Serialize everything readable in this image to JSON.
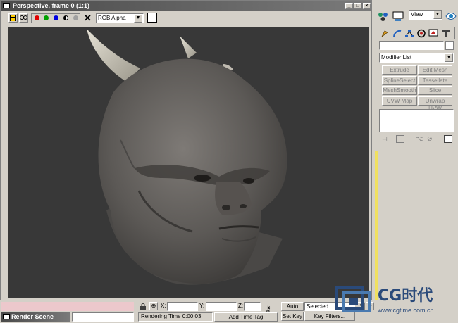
{
  "window": {
    "title": "Perspective, frame 0 (1:1)",
    "controls": [
      "_",
      "□",
      "×"
    ]
  },
  "toolbar": {
    "channel": "RGB Alpha"
  },
  "command_panel": {
    "view_dropdown": "View",
    "modifier_list": "Modifier List",
    "buttons": [
      "Extrude",
      "Edit Mesh",
      "SplineSelect",
      "Tessellate",
      "MeshSmooth",
      "Slice",
      "UVW Map",
      "Unwrap UVW"
    ]
  },
  "bottom_bar": {
    "x_label": "X:",
    "y_label": "Y:",
    "z_label": "Z:",
    "auto_key": "Auto Key",
    "selected": "Selected",
    "set_key": "Set Key",
    "key_filters": "Key Filters...",
    "rendering_time": "Rendering Time  0:00:03",
    "add_time_tag": "Add Time Tag",
    "render_scene": "Render Scene"
  },
  "watermark": {
    "brand": "CG时代",
    "url": "www.cgtime.com.cn"
  },
  "colors": {
    "viewport_bg": "#383838",
    "title_bar": "#5a5a5a",
    "status_pink": "#ecc8cc",
    "channel_red": "#e00000",
    "channel_green": "#00a000",
    "channel_blue": "#0000e0"
  }
}
